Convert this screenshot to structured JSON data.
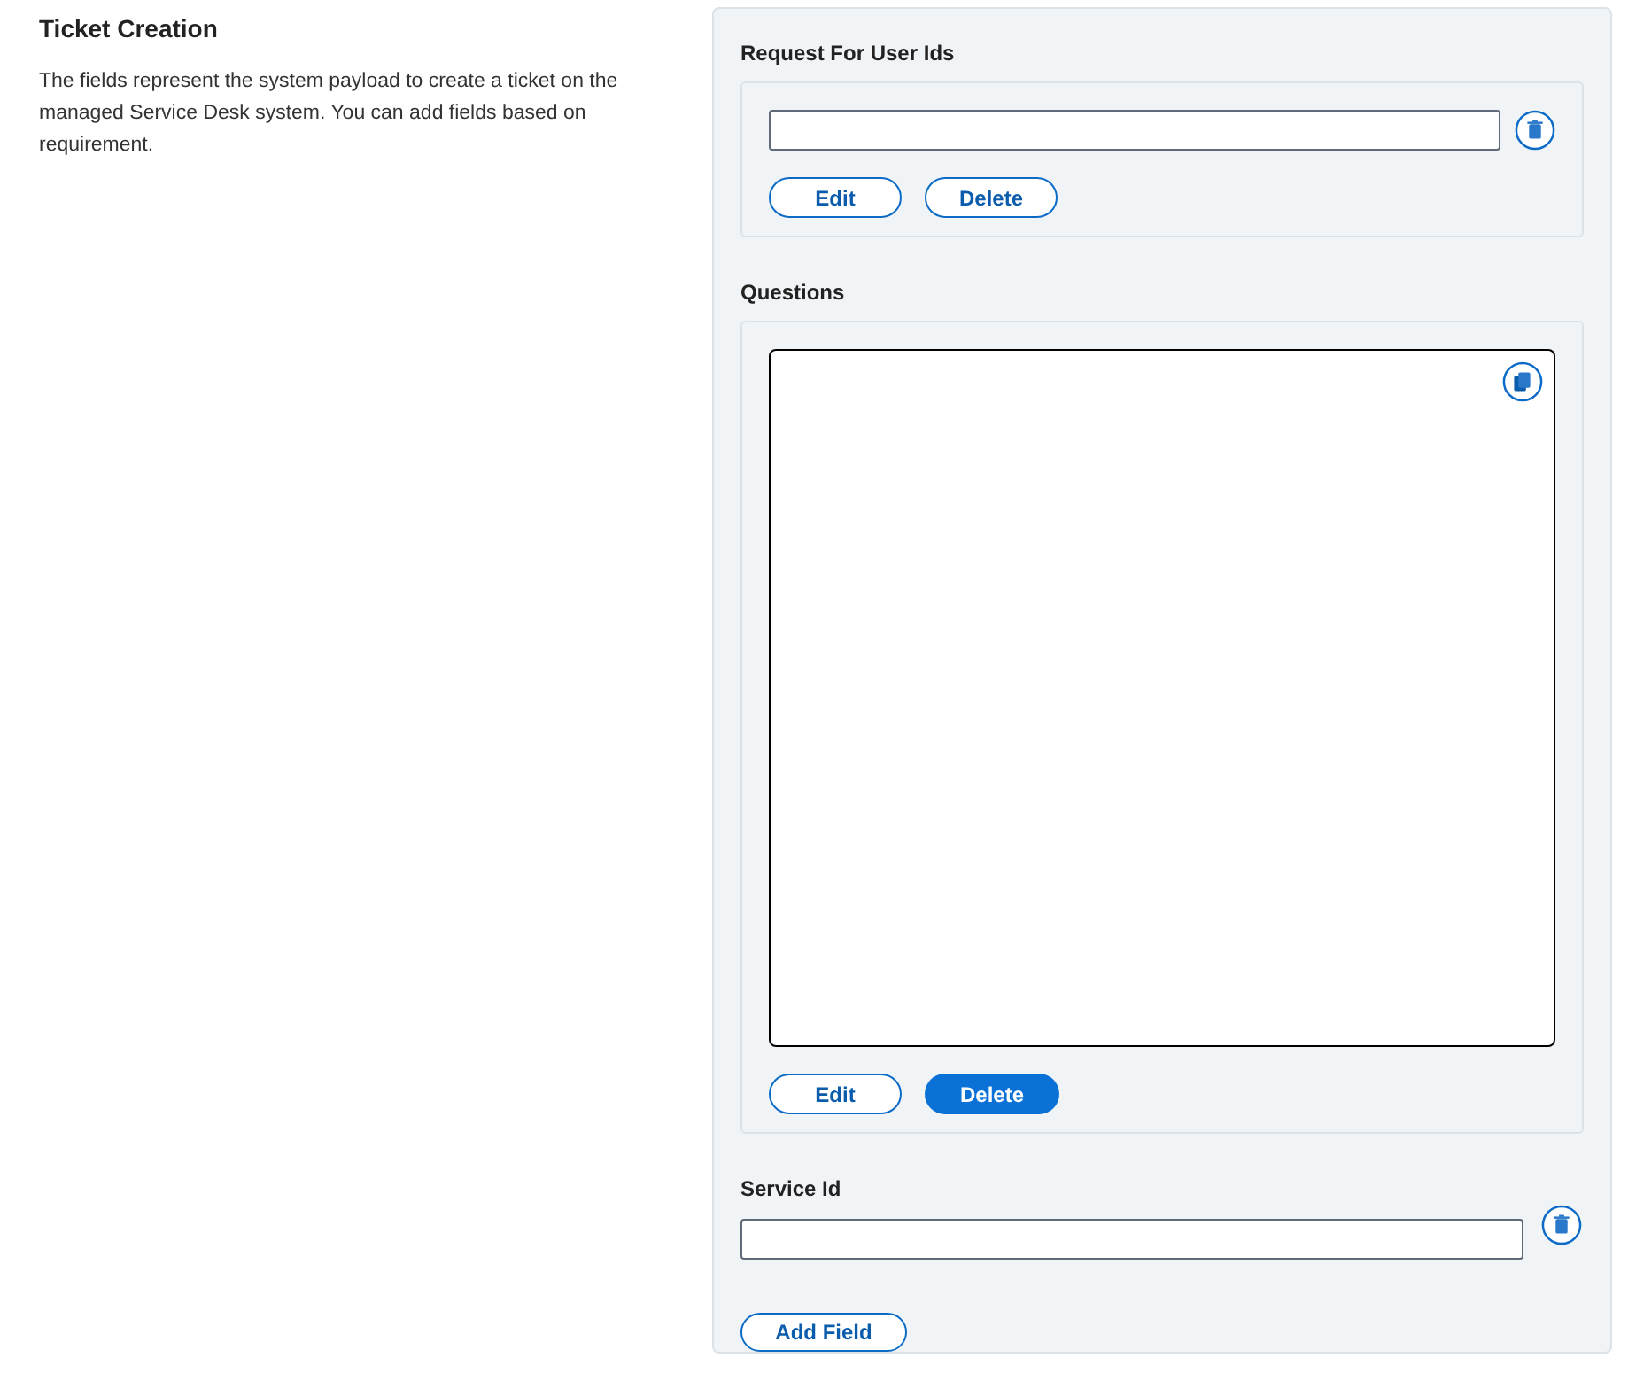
{
  "intro": {
    "title": "Ticket Creation",
    "description": "The fields represent the system payload to create a ticket on the managed Service Desk system. You can add fields based on requirement."
  },
  "fields": [
    {
      "kind": "inputgroup",
      "label": "Request For User Ids",
      "buttons": [
        {
          "label": "Edit",
          "primary": false
        },
        {
          "label": "Delete",
          "primary": false
        }
      ]
    },
    {
      "kind": "textgroup",
      "label": "Questions",
      "buttons": [
        {
          "label": "Edit",
          "primary": false
        },
        {
          "label": "Delete",
          "primary": true
        }
      ]
    },
    {
      "kind": "simple",
      "label": "Service Id"
    }
  ],
  "add_button": {
    "label": "Add Field"
  }
}
